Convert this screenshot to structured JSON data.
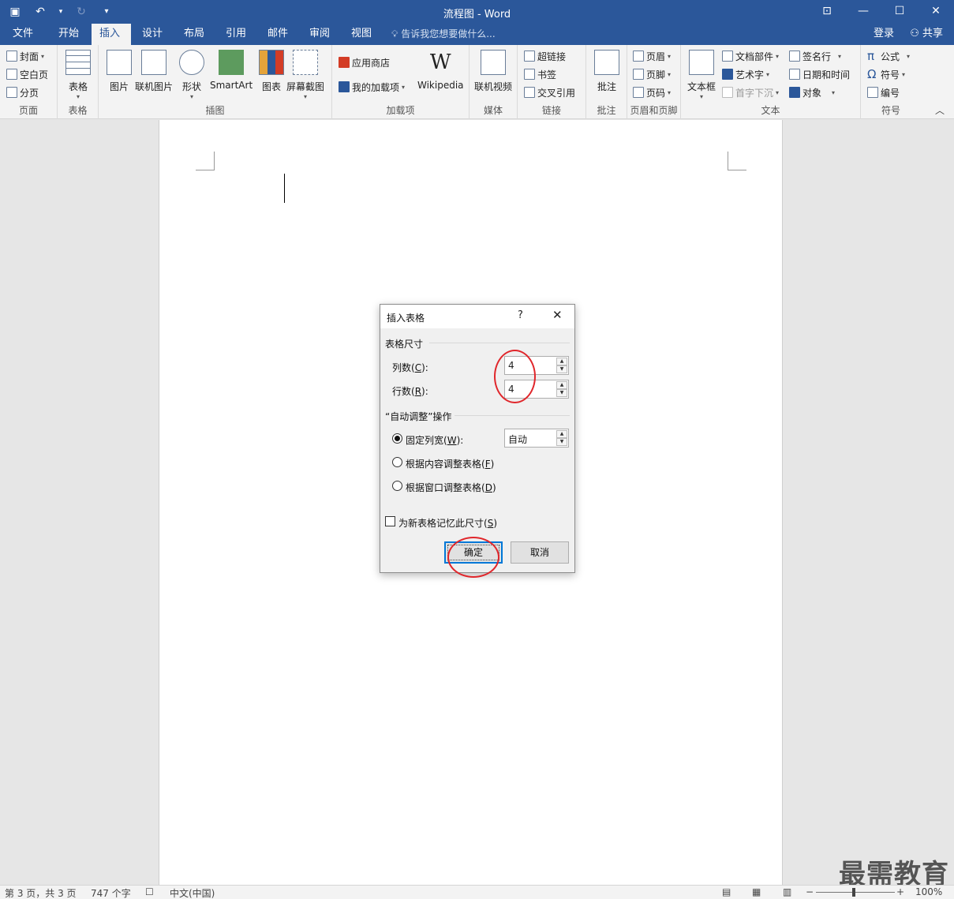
{
  "window": {
    "title": "流程图 - Word"
  },
  "qat": {
    "save": "save-icon",
    "undo": "undo-icon",
    "redo": "redo-icon",
    "customize": "customize-icon"
  },
  "tabs": [
    "文件",
    "开始",
    "插入",
    "设计",
    "布局",
    "引用",
    "邮件",
    "审阅",
    "视图"
  ],
  "active_tab": "插入",
  "tellme": "告诉我您想要做什么...",
  "account": {
    "login": "登录",
    "share": "共享"
  },
  "ribbon": {
    "pages": {
      "label": "页面",
      "items": [
        "封面",
        "空白页",
        "分页"
      ]
    },
    "tables": {
      "label": "表格",
      "item": "表格"
    },
    "illustrations": {
      "label": "插图",
      "items": [
        "图片",
        "联机图片",
        "形状",
        "SmartArt",
        "图表",
        "屏幕截图"
      ]
    },
    "addins": {
      "label": "加载项",
      "store": "应用商店",
      "myaddins": "我的加载项",
      "wiki": "Wikipedia"
    },
    "media": {
      "label": "媒体",
      "item": "联机视频"
    },
    "links": {
      "label": "链接",
      "items": [
        "超链接",
        "书签",
        "交叉引用"
      ]
    },
    "comments": {
      "label": "批注",
      "item": "批注"
    },
    "header_footer": {
      "label": "页眉和页脚",
      "items": [
        "页眉",
        "页脚",
        "页码"
      ]
    },
    "text": {
      "label": "文本",
      "textbox": "文本框",
      "items": [
        "文档部件",
        "艺术字",
        "首字下沉",
        "签名行",
        "日期和时间",
        "对象"
      ]
    },
    "symbols": {
      "label": "符号",
      "items": [
        "公式",
        "符号",
        "编号"
      ]
    }
  },
  "dialog": {
    "title": "插入表格",
    "help": "?",
    "close": "✕",
    "size_section": "表格尺寸",
    "columns_label_pre": "列数(",
    "columns_key": "C",
    "columns_label_post": "):",
    "columns_value": "4",
    "rows_label_pre": "行数(",
    "rows_key": "R",
    "rows_label_post": "):",
    "rows_value": "4",
    "autofit_section": "“自动调整”操作",
    "fixed_pre": "固定列宽(",
    "fixed_key": "W",
    "fixed_post": "):",
    "fixed_value": "自动",
    "content_pre": "根据内容调整表格(",
    "content_key": "F",
    "content_post": ")",
    "window_pre": "根据窗口调整表格(",
    "window_key": "D",
    "window_post": ")",
    "remember_pre": "为新表格记忆此尺寸(",
    "remember_key": "S",
    "remember_post": ")",
    "ok": "确定",
    "cancel": "取消"
  },
  "status": {
    "page": "第 3 页，共 3 页",
    "words": "747 个字",
    "lang": "中文(中国)",
    "zoom": "100%"
  },
  "watermark": "最需教育"
}
